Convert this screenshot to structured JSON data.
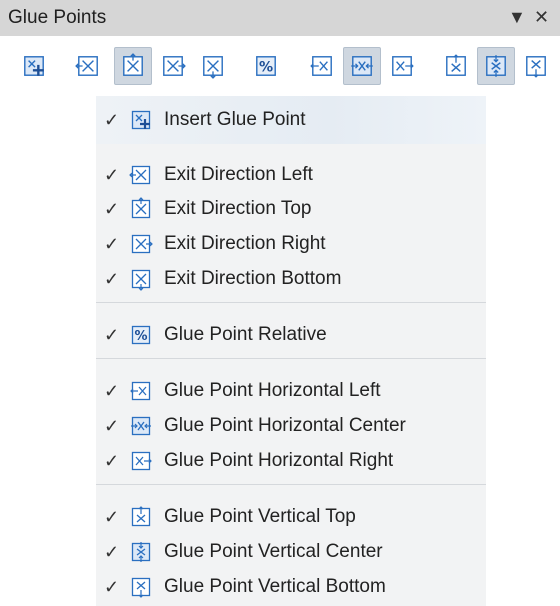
{
  "panel": {
    "title": "Glue Points",
    "dropdown_glyph": "▼",
    "close_glyph": "✕"
  },
  "toolbar": [
    {
      "id": "insert",
      "icon": "insert-glue-point-icon",
      "checked": false
    },
    {
      "id": "exit-left",
      "icon": "exit-direction-left-icon",
      "checked": false
    },
    {
      "id": "exit-top",
      "icon": "exit-direction-top-icon",
      "checked": true
    },
    {
      "id": "exit-right",
      "icon": "exit-direction-right-icon",
      "checked": false
    },
    {
      "id": "exit-bottom",
      "icon": "exit-direction-bottom-icon",
      "checked": false
    },
    {
      "id": "relative",
      "icon": "glue-point-relative-icon",
      "checked": false
    },
    {
      "id": "h-left",
      "icon": "horizontal-left-icon",
      "checked": false
    },
    {
      "id": "h-center",
      "icon": "horizontal-center-icon",
      "checked": true
    },
    {
      "id": "h-right",
      "icon": "horizontal-right-icon",
      "checked": false
    },
    {
      "id": "v-top",
      "icon": "vertical-top-icon",
      "checked": false
    },
    {
      "id": "v-center",
      "icon": "vertical-center-icon",
      "checked": true
    },
    {
      "id": "v-bottom",
      "icon": "vertical-bottom-icon",
      "checked": false
    }
  ],
  "menu": {
    "check_glyph": "✓",
    "items": [
      {
        "label": "Insert Glue Point",
        "icon": "insert-glue-point-icon",
        "checked": true
      },
      {
        "label": "Exit Direction Left",
        "icon": "exit-direction-left-icon",
        "checked": true
      },
      {
        "label": "Exit Direction Top",
        "icon": "exit-direction-top-icon",
        "checked": true
      },
      {
        "label": "Exit Direction Right",
        "icon": "exit-direction-right-icon",
        "checked": true
      },
      {
        "label": "Exit Direction Bottom",
        "icon": "exit-direction-bottom-icon",
        "checked": true
      },
      {
        "label": "Glue Point Relative",
        "icon": "glue-point-relative-icon",
        "checked": true
      },
      {
        "label": "Glue Point Horizontal Left",
        "icon": "horizontal-left-icon",
        "checked": true
      },
      {
        "label": "Glue Point Horizontal Center",
        "icon": "horizontal-center-icon",
        "checked": true
      },
      {
        "label": "Glue Point Horizontal Right",
        "icon": "horizontal-right-icon",
        "checked": true
      },
      {
        "label": "Glue Point Vertical Top",
        "icon": "vertical-top-icon",
        "checked": true
      },
      {
        "label": "Glue Point Vertical Center",
        "icon": "vertical-center-icon",
        "checked": true
      },
      {
        "label": "Glue Point Vertical Bottom",
        "icon": "vertical-bottom-icon",
        "checked": true
      }
    ]
  },
  "colors": {
    "icon_blue": "#2a6fc0",
    "title_bg": "#d6d6d6",
    "menu_bg": "#f2f3f4",
    "checked_bg": "#cfd7e0"
  }
}
